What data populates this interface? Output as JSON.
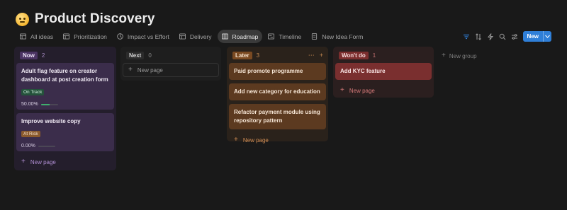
{
  "header": {
    "title": "Product Discovery",
    "icon": "thinking-face-emoji"
  },
  "tabs": [
    {
      "label": "All ideas",
      "icon": "table-icon",
      "active": false
    },
    {
      "label": "Prioritization",
      "icon": "table-icon",
      "active": false
    },
    {
      "label": "Impact vs Effort",
      "icon": "chart-icon",
      "active": false
    },
    {
      "label": "Delivery",
      "icon": "table-icon",
      "active": false
    },
    {
      "label": "Roadmap",
      "icon": "board-icon",
      "active": true
    },
    {
      "label": "Timeline",
      "icon": "timeline-icon",
      "active": false
    },
    {
      "label": "New Idea Form",
      "icon": "form-icon",
      "active": false
    }
  ],
  "toolbar": {
    "new_label": "New"
  },
  "columns": {
    "now": {
      "label": "Now",
      "count": "2",
      "cards": [
        {
          "title": "Adult flag feature on creator dashboard at post creation form",
          "status": "On Track",
          "progress_label": "50.00%",
          "progress": 0.5
        },
        {
          "title": "Improve website copy",
          "status": "At Risk",
          "progress_label": "0.00%",
          "progress": 0
        }
      ],
      "new_page": "New page"
    },
    "next": {
      "label": "Next",
      "count": "0",
      "new_page": "New page"
    },
    "later": {
      "label": "Later",
      "count": "3",
      "cards": [
        {
          "title": "Paid promote programme"
        },
        {
          "title": "Add new category for education"
        },
        {
          "title": "Refactor payment module using repository pattern"
        }
      ],
      "new_page": "New page"
    },
    "wontdo": {
      "label": "Won't do",
      "count": "1",
      "cards": [
        {
          "title": "Add KYC feature"
        }
      ],
      "new_page": "New page"
    }
  },
  "add_group_label": "New group",
  "colors": {
    "background": "#191919",
    "accent": "#2f7fd8",
    "now": "#4b3463",
    "later": "#7a4a22",
    "wontdo": "#7b2e2e",
    "on_track": "#24523b",
    "at_risk": "#8a5a2d"
  }
}
